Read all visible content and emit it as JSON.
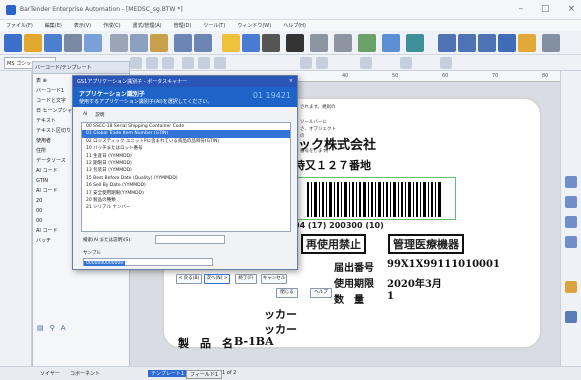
{
  "window": {
    "title": "BarTender Enterprise Automation - [MEDSC_sg.BTW *]"
  },
  "menu": [
    "ファイル(F)",
    "編集(E)",
    "表示(V)",
    "作成(C)",
    "書式/管理(A)",
    "管理(D)",
    "ツール(T)",
    "ウィンドウ(W)",
    "ヘルプ(H)"
  ],
  "toolbar": {
    "font_name": "MS ゴシック"
  },
  "panel": {
    "title": "バーコード/テンプレート",
    "items": [
      "表 ⊕",
      "バーコード1",
      "コードと文字",
      "日 ヒーンプシャン",
      "テキスト",
      "テキスト区切り",
      "使用者",
      "住所",
      "データソース",
      "AI コード",
      "GTIN",
      "AI コード",
      "20",
      "00",
      "00",
      "AI コード",
      "バッチ"
    ]
  },
  "dialog": {
    "title": "GS1アプリケーション識別子 - ポータスキャナー",
    "header": "アプリケーション識別子",
    "subheader": "使用するアプリケーション識別子(AI)を選択してください。",
    "header_number": "01 19421",
    "col_ai": "AI",
    "col_desc": "説明",
    "items": [
      "00 SSCC-18 Serial Shipping Container Code",
      "01 Global Trade Item Number (GTIN)",
      "02 ロジスティック ユニットPに含まれている商品の品目符(GTIN)",
      "10 バッチまたはロット番号",
      "11 生産日 (YYMMDD)",
      "12 期限日 (YYMMDD)",
      "13 包装日 (YYMMDD)",
      "15 Best Before Date (Quality) (YYMMDD)",
      "16 Sell By Date (YYMMDD)",
      "17 安全使用期限(YYMMDD)",
      "20 製品の種類",
      "21 シリアル ナンバー"
    ],
    "search_label": "検索(AI または説明)(S):",
    "sample_label": "サンプル",
    "sample_value": "0000000000000",
    "buttons": {
      "back": "< 戻る(B)",
      "next": "次へ(N) >",
      "finish": "終了(F)",
      "cancel": "キャンセル",
      "close": "閉じる",
      "help": "ヘルプ"
    }
  },
  "side_note": [
    "されます。規則の",
    "ソールバーに",
    "さ、オブジェクトの",
    "番号をします。"
  ],
  "label": {
    "company": "ック株式会社",
    "address": "時又１２７番地",
    "barcode_text": "04 (17) 200300 (10)",
    "company2": "社",
    "badge1": "再使用禁止",
    "badge2": "管理医療機器",
    "field1_label": "届出番号",
    "field1_value": "99X1X99111010001",
    "field2_label": "使用期限",
    "field2_value": "2020年3月",
    "field3_label": "数　量",
    "field3_value": "1",
    "maker1": "ッカー",
    "maker2": "ッカー",
    "product_label": "製　品　名",
    "product_value": "B-1BA"
  },
  "ruler_marks": [
    "40",
    "50",
    "60",
    "70",
    "80"
  ],
  "status": {
    "left1": "ソイヤー",
    "left2": "コボーネント",
    "page": "1 of 2",
    "tab1": "テンプレート1",
    "tab2": "フィールド1"
  },
  "colors": {
    "accent": "#1e64c8",
    "selection": "#3173d6"
  }
}
